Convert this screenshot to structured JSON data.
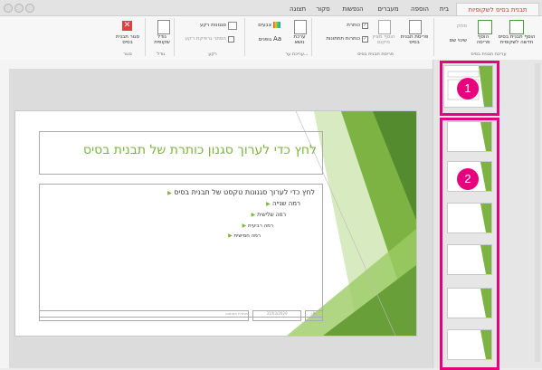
{
  "tabs": [
    "תבנית בסיס לשקופיות",
    "בית",
    "הוספה",
    "מעברים",
    "הנפשות",
    "סקור",
    "תצוגה"
  ],
  "ribbon": {
    "insert_master": "הוסף תבנית בסיס חדשה לשקופית",
    "insert_layout": "הוסף פריסה",
    "delete": "מחק",
    "rename": "שינוי שם",
    "group_edit_master": "עריכת תבנית בסיס",
    "master_layout": "פריסת תבנית בסיס",
    "insert_placeholder": "הוסף מציין מיקום",
    "title_check": "כותרת",
    "footers_check": "כותרות תחתונות",
    "group_master_layout": "פריסת תבנית בסיס",
    "edit_theme": "ערכת נושא",
    "group_edit_theme": "עריכת ער...",
    "colors": "צבעים",
    "fonts": "גופנים",
    "background_styles": "סגנונות רקע",
    "hide_background": "הסתר גרפיקת רקע",
    "group_background": "רקע",
    "slide_size": "גודל שקופית",
    "group_size": "גודל",
    "close_master": "סגור תבנית בסיס",
    "group_close": "סגור"
  },
  "slide": {
    "title": "לחץ כדי לערוך סגנון כותרת של תבנית בסיס",
    "levels": [
      "לחץ כדי לערוך סגנונות טקסט של תבנית בסיס",
      "רמה שנייה",
      "רמה שלישית",
      "רמה רביעית",
      "רמה חמישית"
    ],
    "date": "31/03/2020",
    "footer": "כותרת תחתונה",
    "page_num": "‹#›"
  },
  "callouts": {
    "one": "1",
    "two": "2"
  },
  "colors": {
    "accent_tab": "#c0392b",
    "highlight": "#e6007e",
    "green": "#7cb342"
  }
}
